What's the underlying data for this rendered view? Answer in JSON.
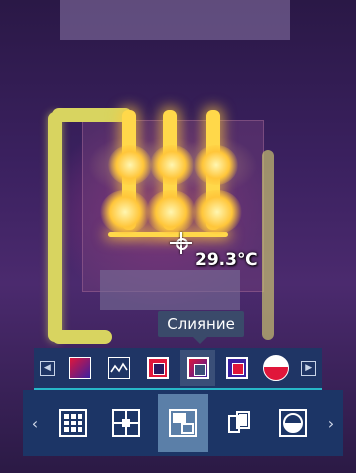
{
  "reading": {
    "temperature": "29.3℃"
  },
  "tooltip": {
    "label": "Слияние"
  },
  "palette_bar": {
    "prev_icon": "small-left-arrow-icon",
    "next_icon": "small-right-arrow-icon",
    "items": [
      {
        "name": "palette-gradient-red-blue",
        "selected": false
      },
      {
        "name": "palette-waveform",
        "selected": false
      },
      {
        "name": "palette-square-red",
        "selected": false
      },
      {
        "name": "palette-fusion",
        "selected": true
      },
      {
        "name": "palette-square-red-2",
        "selected": false
      },
      {
        "name": "palette-circle-red-white",
        "selected": false
      }
    ]
  },
  "mode_bar": {
    "prev_icon": "chevron-left-icon",
    "next_icon": "chevron-right-icon",
    "items": [
      {
        "name": "grid-icon",
        "selected": false
      },
      {
        "name": "center-spot-icon",
        "selected": false
      },
      {
        "name": "picture-in-picture-icon",
        "selected": true
      },
      {
        "name": "side-by-side-icon",
        "selected": false
      },
      {
        "name": "half-circle-icon",
        "selected": false
      }
    ]
  },
  "colors": {
    "toolbar_bg": "#1c3566",
    "selected_bg": "#5b7fa8",
    "accent_line": "#27b8c8",
    "tooltip_bg": "#3a4a6a"
  }
}
